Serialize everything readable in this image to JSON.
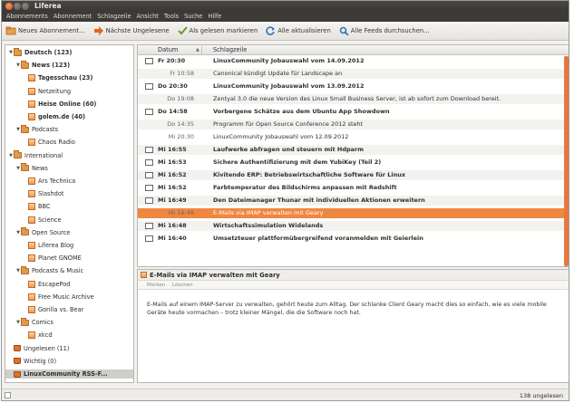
{
  "window": {
    "title": "Liferea"
  },
  "menu": [
    "Abonnements",
    "Abonnement",
    "Schlagzeile",
    "Ansicht",
    "Tools",
    "Suche",
    "Hilfe"
  ],
  "toolbar": {
    "new_subscription": "Neues Abonnement...",
    "next_unread": "Nächste Ungelesene",
    "mark_all_read": "Als gelesen markieren",
    "update_all": "Alle aktualisieren",
    "search_all": "Alle Feeds durchsuchen..."
  },
  "sidebar": [
    {
      "label": "Deutsch (123)",
      "level": 0,
      "type": "folder",
      "expanded": true,
      "bold": true
    },
    {
      "label": "News (123)",
      "level": 1,
      "type": "folder",
      "expanded": true,
      "bold": true
    },
    {
      "label": "Tagesschau (23)",
      "level": 2,
      "type": "feed",
      "bold": true
    },
    {
      "label": "Netzeitung",
      "level": 2,
      "type": "feed",
      "bold": false
    },
    {
      "label": "Heise Online (60)",
      "level": 2,
      "type": "feed",
      "bold": true
    },
    {
      "label": "golem.de (40)",
      "level": 2,
      "type": "feed",
      "bold": true
    },
    {
      "label": "Podcasts",
      "level": 1,
      "type": "folder",
      "expanded": true,
      "bold": false
    },
    {
      "label": "Chaos Radio",
      "level": 2,
      "type": "feed",
      "bold": false
    },
    {
      "label": "International",
      "level": 0,
      "type": "folder",
      "expanded": true,
      "bold": false
    },
    {
      "label": "News",
      "level": 1,
      "type": "folder",
      "expanded": true,
      "bold": false
    },
    {
      "label": "Ars Technica",
      "level": 2,
      "type": "feed",
      "bold": false
    },
    {
      "label": "Slashdot",
      "level": 2,
      "type": "feed",
      "bold": false
    },
    {
      "label": "BBC",
      "level": 2,
      "type": "feed",
      "bold": false
    },
    {
      "label": "Science",
      "level": 2,
      "type": "feed",
      "bold": false
    },
    {
      "label": "Open Source",
      "level": 1,
      "type": "folder",
      "expanded": true,
      "bold": false
    },
    {
      "label": "Liferea Blog",
      "level": 2,
      "type": "feed",
      "bold": false
    },
    {
      "label": "Planet GNOME",
      "level": 2,
      "type": "feed",
      "bold": false
    },
    {
      "label": "Podcasts & Music",
      "level": 1,
      "type": "folder",
      "expanded": true,
      "bold": false
    },
    {
      "label": "EscapePod",
      "level": 2,
      "type": "feed",
      "bold": false
    },
    {
      "label": "Free Music Archive",
      "level": 2,
      "type": "feed",
      "bold": false
    },
    {
      "label": "Gorilla vs. Bear",
      "level": 2,
      "type": "feed",
      "bold": false
    },
    {
      "label": "Comics",
      "level": 1,
      "type": "folder",
      "expanded": true,
      "bold": false
    },
    {
      "label": "xkcd",
      "level": 2,
      "type": "feed",
      "bold": false
    },
    {
      "label": "Ungelesen (11)",
      "level": 0,
      "type": "bucket",
      "bold": false
    },
    {
      "label": "Wichtig (0)",
      "level": 0,
      "type": "bucket",
      "bold": false
    },
    {
      "label": "LinuxCommunity RSS-F...",
      "level": 0,
      "type": "bucket",
      "bold": true,
      "selected": true
    }
  ],
  "list": {
    "col_date": "Datum",
    "col_subject": "Schlagzeile",
    "articles": [
      {
        "date": "Fr 20:30",
        "subject": "LinuxCommunity Jobauswahl vom 14.09.2012",
        "unread": true
      },
      {
        "date": "Fr 10:58",
        "subject": "Canonical kündigt Update für Landscape an",
        "unread": false
      },
      {
        "date": "Do 20:30",
        "subject": "LinuxCommunity Jobauswahl vom 13.09.2012",
        "unread": true
      },
      {
        "date": "Do 19:08",
        "subject": "Zentyal 3.0 die neue Version des Linux Small Business Server, ist ab sofort zum Download bereit.",
        "unread": false
      },
      {
        "date": "Do 14:58",
        "subject": "Vorbergene Schätze aus dem Ubuntu App Showdown",
        "unread": true
      },
      {
        "date": "Do 14:35",
        "subject": "Programm für Open Source Conference 2012 steht",
        "unread": false
      },
      {
        "date": "Mi 20:30",
        "subject": "LinuxCommunity Jobauswahl vom 12.09.2012",
        "unread": false
      },
      {
        "date": "Mi 16:55",
        "subject": "Laufwerke abfragen und steuern mit Hdparm",
        "unread": true
      },
      {
        "date": "Mi 16:53",
        "subject": "Sichere Authentifizierung mit dem YubiKey (Teil 2)",
        "unread": true
      },
      {
        "date": "Mi 16:52",
        "subject": "Kivitendo ERP: Betriebswirtschaftliche Software für Linux",
        "unread": true
      },
      {
        "date": "Mi 16:52",
        "subject": "Farbtemperatur des Bildschirms anpassen mit Redshift",
        "unread": true
      },
      {
        "date": "Mi 16:49",
        "subject": "Den Dateimanager Thunar mit individuellen Aktionen erweitern",
        "unread": true
      },
      {
        "date": "Mi 16:48",
        "subject": "E-Mails via IMAP verwalten mit Geary",
        "unread": false,
        "selected": true
      },
      {
        "date": "Mi 16:48",
        "subject": "Wirtschaftssimulation Widelands",
        "unread": true
      },
      {
        "date": "Mi 16:40",
        "subject": "Umsetzteuer plattformübergreifend voranmelden mit Geierlein",
        "unread": true
      }
    ]
  },
  "preview": {
    "title": "E-Mails via IMAP verwalten mit Geary",
    "tag_mark": "Merken",
    "tag_delete": "Löschen",
    "body": "E-Mails auf einem IMAP-Server zu verwalten, gehört heute zum Alltag. Der schlanke Client Geary macht dies so einfach, wie es viele mobile Geräte heute vormachen – trotz kleiner Mängel, die die Software noch hat."
  },
  "status": {
    "unread": "138 ungelesen"
  },
  "colors": {
    "accent": "#f08740",
    "titlebar": "#3c3b37"
  }
}
